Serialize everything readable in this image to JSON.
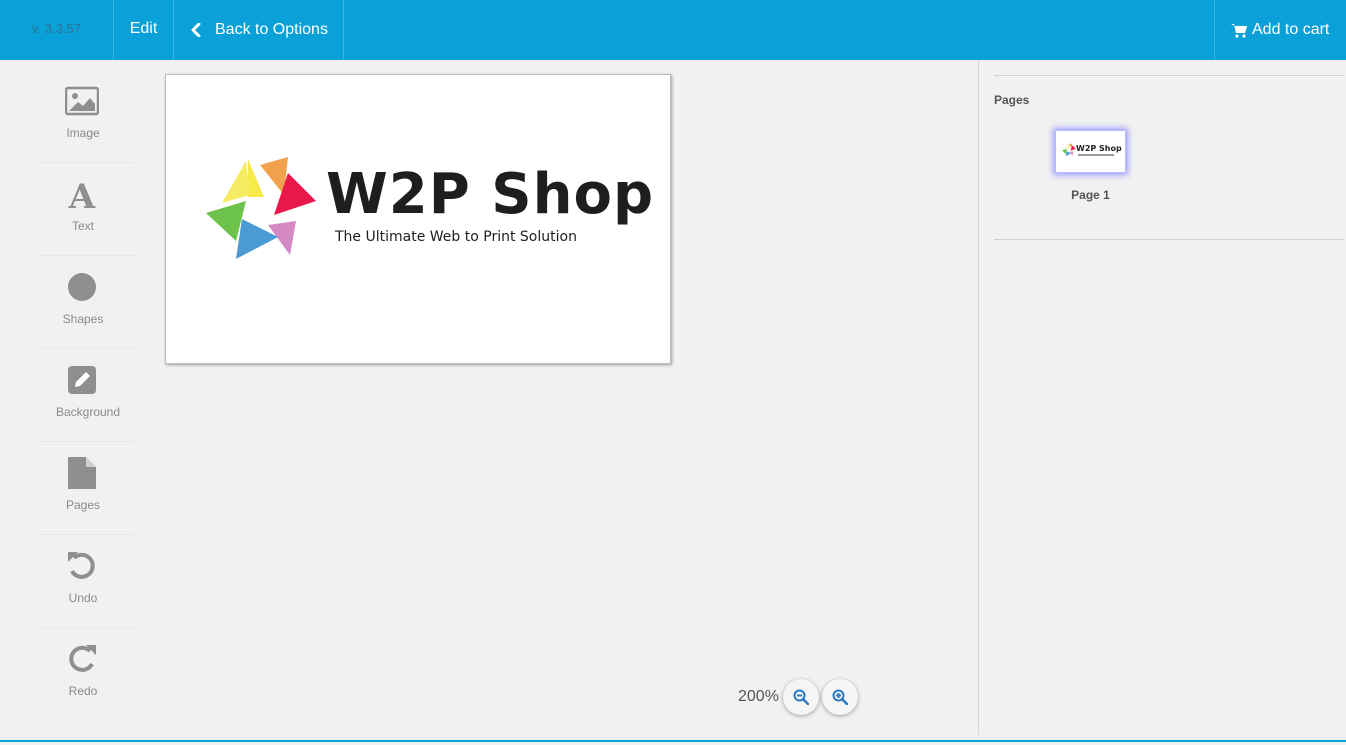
{
  "header": {
    "version": "v. 3.3.57",
    "edit_label": "Edit",
    "back_label": "Back to Options",
    "cart_label": "Add to cart"
  },
  "toolbar": {
    "image": "Image",
    "text": "Text",
    "shapes": "Shapes",
    "background": "Background",
    "pages": "Pages",
    "undo": "Undo",
    "redo": "Redo"
  },
  "canvas": {
    "logo_title": "W2P Shop",
    "logo_subtitle": "The Ultimate Web to Print Solution"
  },
  "zoom": {
    "level": "200%"
  },
  "pages_panel": {
    "title": "Pages",
    "pages": [
      {
        "label": "Page 1",
        "thumb_title": "W2P Shop"
      }
    ]
  },
  "colors": {
    "accent": "#0aa0d8",
    "icon_gray": "#8f8f8f",
    "zoom_icon": "#2b78c2"
  }
}
